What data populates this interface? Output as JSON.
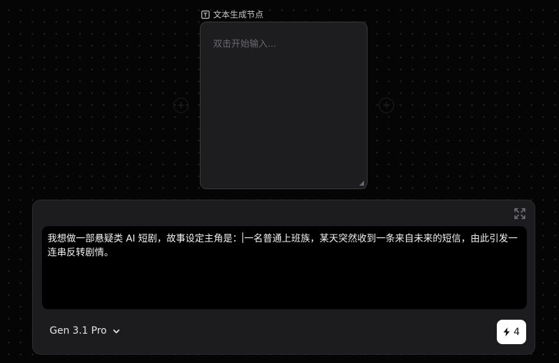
{
  "node": {
    "title": "文本生成节点",
    "title_icon": "text-box-icon",
    "placeholder": "双击开始输入..."
  },
  "prompt": {
    "text_before_caret": "我想做一部悬疑类 AI 短剧，故事设定主角是：",
    "text_after_caret": "一名普通上班族，某天突然收到一条来自未来的短信，由此引发一连串反转剧情。"
  },
  "toolbar": {
    "model_label": "Gen 3.1 Pro",
    "credits": "4",
    "credit_icon": "lightning-icon",
    "expand_icon": "expand-icon"
  },
  "ports": {
    "left_symbol": "+",
    "right_symbol": "+"
  }
}
